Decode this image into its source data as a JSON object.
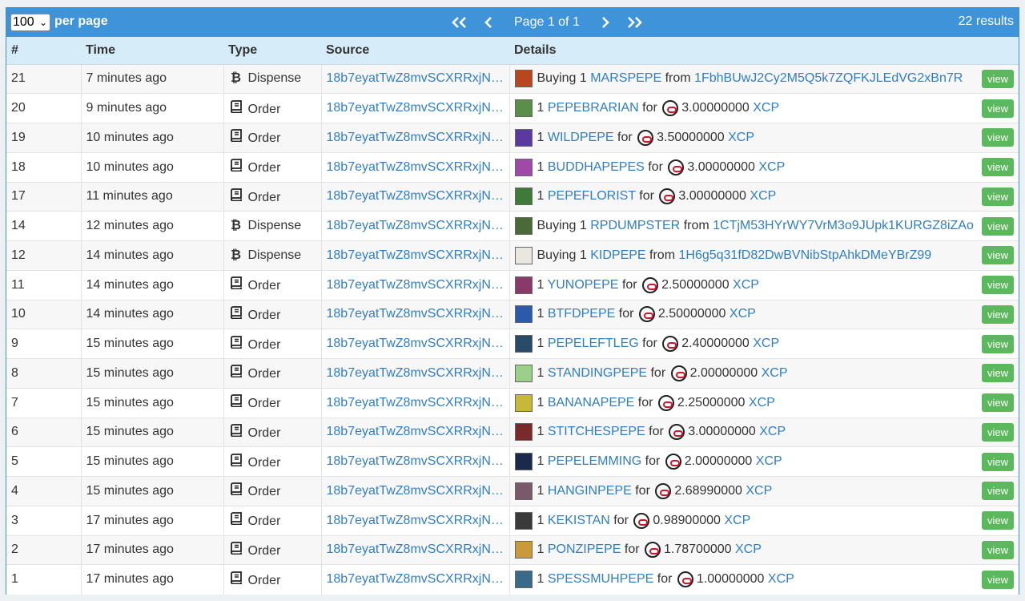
{
  "pager": {
    "per_page_value": "100",
    "per_page_label": "per page",
    "first_icon": "double-chevron-left",
    "prev_icon": "chevron-left",
    "page_text": "Page 1 of 1",
    "next_icon": "chevron-right",
    "last_icon": "double-chevron-right",
    "results": "22 results"
  },
  "columns": [
    "#",
    "Time",
    "Type",
    "Source",
    "Details"
  ],
  "view_label": "view",
  "colors": {
    "accent": "#3f93d9",
    "header": "#d6ecf9",
    "link": "#2f7ec4",
    "view": "#5cb85c"
  },
  "rows": [
    {
      "num": "21",
      "time": "7 minutes ago",
      "type": "Dispense",
      "source": "18b7eyatTwZ8mvSCXRRxjNj...",
      "kind": "dispense",
      "w1": "Buying 1",
      "asset": "MARSPEPE",
      "w2": "from",
      "addr": "1FbhBUwJ2Cy2M5Q5k7ZQFKJLEdVG2xBn7R",
      "thumb": "#b8461f"
    },
    {
      "num": "20",
      "time": "9 minutes ago",
      "type": "Order",
      "source": "18b7eyatTwZ8mvSCXRRxjNj...",
      "kind": "order",
      "w1": "1",
      "asset": "PEPEBRARIAN",
      "w2": "for",
      "price": "3.00000000",
      "unit": "XCP",
      "thumb": "#5a8f4a"
    },
    {
      "num": "19",
      "time": "10 minutes ago",
      "type": "Order",
      "source": "18b7eyatTwZ8mvSCXRRxjNj...",
      "kind": "order",
      "w1": "1",
      "asset": "WILDPEPE",
      "w2": "for",
      "price": "3.50000000",
      "unit": "XCP",
      "thumb": "#5a3aa0"
    },
    {
      "num": "18",
      "time": "10 minutes ago",
      "type": "Order",
      "source": "18b7eyatTwZ8mvSCXRRxjNj...",
      "kind": "order",
      "w1": "1",
      "asset": "BUDDHAPEPES",
      "w2": "for",
      "price": "3.00000000",
      "unit": "XCP",
      "thumb": "#a04aa8"
    },
    {
      "num": "17",
      "time": "11 minutes ago",
      "type": "Order",
      "source": "18b7eyatTwZ8mvSCXRRxjNj...",
      "kind": "order",
      "w1": "1",
      "asset": "PEPEFLORIST",
      "w2": "for",
      "price": "3.00000000",
      "unit": "XCP",
      "thumb": "#3f7a3a"
    },
    {
      "num": "14",
      "time": "12 minutes ago",
      "type": "Dispense",
      "source": "18b7eyatTwZ8mvSCXRRxjNj...",
      "kind": "dispense",
      "w1": "Buying 1",
      "asset": "RPDUMPSTER",
      "w2": "from",
      "addr": "1CTjM53HYrWY7VrM3o9JUpk1KURGZ8iZAo",
      "thumb": "#4a6a3a"
    },
    {
      "num": "12",
      "time": "14 minutes ago",
      "type": "Dispense",
      "source": "18b7eyatTwZ8mvSCXRRxjNj...",
      "kind": "dispense",
      "w1": "Buying 1",
      "asset": "KIDPEPE",
      "w2": "from",
      "addr": "1H6g5q31fD82DwBVNibStpAhkDMeYBrZ99",
      "thumb": "#e8e8e0"
    },
    {
      "num": "11",
      "time": "14 minutes ago",
      "type": "Order",
      "source": "18b7eyatTwZ8mvSCXRRxjNj...",
      "kind": "order",
      "w1": "1",
      "asset": "YUNOPEPE",
      "w2": "for",
      "price": "2.50000000",
      "unit": "XCP",
      "thumb": "#8a3a6a"
    },
    {
      "num": "10",
      "time": "14 minutes ago",
      "type": "Order",
      "source": "18b7eyatTwZ8mvSCXRRxjNj...",
      "kind": "order",
      "w1": "1",
      "asset": "BTFDPEPE",
      "w2": "for",
      "price": "2.50000000",
      "unit": "XCP",
      "thumb": "#2a5aa8"
    },
    {
      "num": "9",
      "time": "15 minutes ago",
      "type": "Order",
      "source": "18b7eyatTwZ8mvSCXRRxjNj...",
      "kind": "order",
      "w1": "1",
      "asset": "PEPELEFTLEG",
      "w2": "for",
      "price": "2.40000000",
      "unit": "XCP",
      "thumb": "#2a4a6a"
    },
    {
      "num": "8",
      "time": "15 minutes ago",
      "type": "Order",
      "source": "18b7eyatTwZ8mvSCXRRxjNj...",
      "kind": "order",
      "w1": "1",
      "asset": "STANDINGPEPE",
      "w2": "for",
      "price": "2.00000000",
      "unit": "XCP",
      "thumb": "#9ad08a"
    },
    {
      "num": "7",
      "time": "15 minutes ago",
      "type": "Order",
      "source": "18b7eyatTwZ8mvSCXRRxjNj...",
      "kind": "order",
      "w1": "1",
      "asset": "BANANAPEPE",
      "w2": "for",
      "price": "2.25000000",
      "unit": "XCP",
      "thumb": "#c8b83a"
    },
    {
      "num": "6",
      "time": "15 minutes ago",
      "type": "Order",
      "source": "18b7eyatTwZ8mvSCXRRxjNj...",
      "kind": "order",
      "w1": "1",
      "asset": "STITCHESPEPE",
      "w2": "for",
      "price": "3.00000000",
      "unit": "XCP",
      "thumb": "#7a2a2a"
    },
    {
      "num": "5",
      "time": "15 minutes ago",
      "type": "Order",
      "source": "18b7eyatTwZ8mvSCXRRxjNj...",
      "kind": "order",
      "w1": "1",
      "asset": "PEPELEMMING",
      "w2": "for",
      "price": "2.00000000",
      "unit": "XCP",
      "thumb": "#1a2a4a"
    },
    {
      "num": "4",
      "time": "15 minutes ago",
      "type": "Order",
      "source": "18b7eyatTwZ8mvSCXRRxjNj...",
      "kind": "order",
      "w1": "1",
      "asset": "HANGINPEPE",
      "w2": "for",
      "price": "2.68990000",
      "unit": "XCP",
      "thumb": "#7a5a6a"
    },
    {
      "num": "3",
      "time": "17 minutes ago",
      "type": "Order",
      "source": "18b7eyatTwZ8mvSCXRRxjNj...",
      "kind": "order",
      "w1": "1",
      "asset": "KEKISTAN",
      "w2": "for",
      "price": "0.98900000",
      "unit": "XCP",
      "thumb": "#3a3a3a"
    },
    {
      "num": "2",
      "time": "17 minutes ago",
      "type": "Order",
      "source": "18b7eyatTwZ8mvSCXRRxjNj...",
      "kind": "order",
      "w1": "1",
      "asset": "PONZIPEPE",
      "w2": "for",
      "price": "1.78700000",
      "unit": "XCP",
      "thumb": "#c89a3a"
    },
    {
      "num": "1",
      "time": "17 minutes ago",
      "type": "Order",
      "source": "18b7eyatTwZ8mvSCXRRxjNj...",
      "kind": "order",
      "w1": "1",
      "asset": "SPESSMUHPEPE",
      "w2": "for",
      "price": "1.00000000",
      "unit": "XCP",
      "thumb": "#3a6a8a"
    }
  ]
}
